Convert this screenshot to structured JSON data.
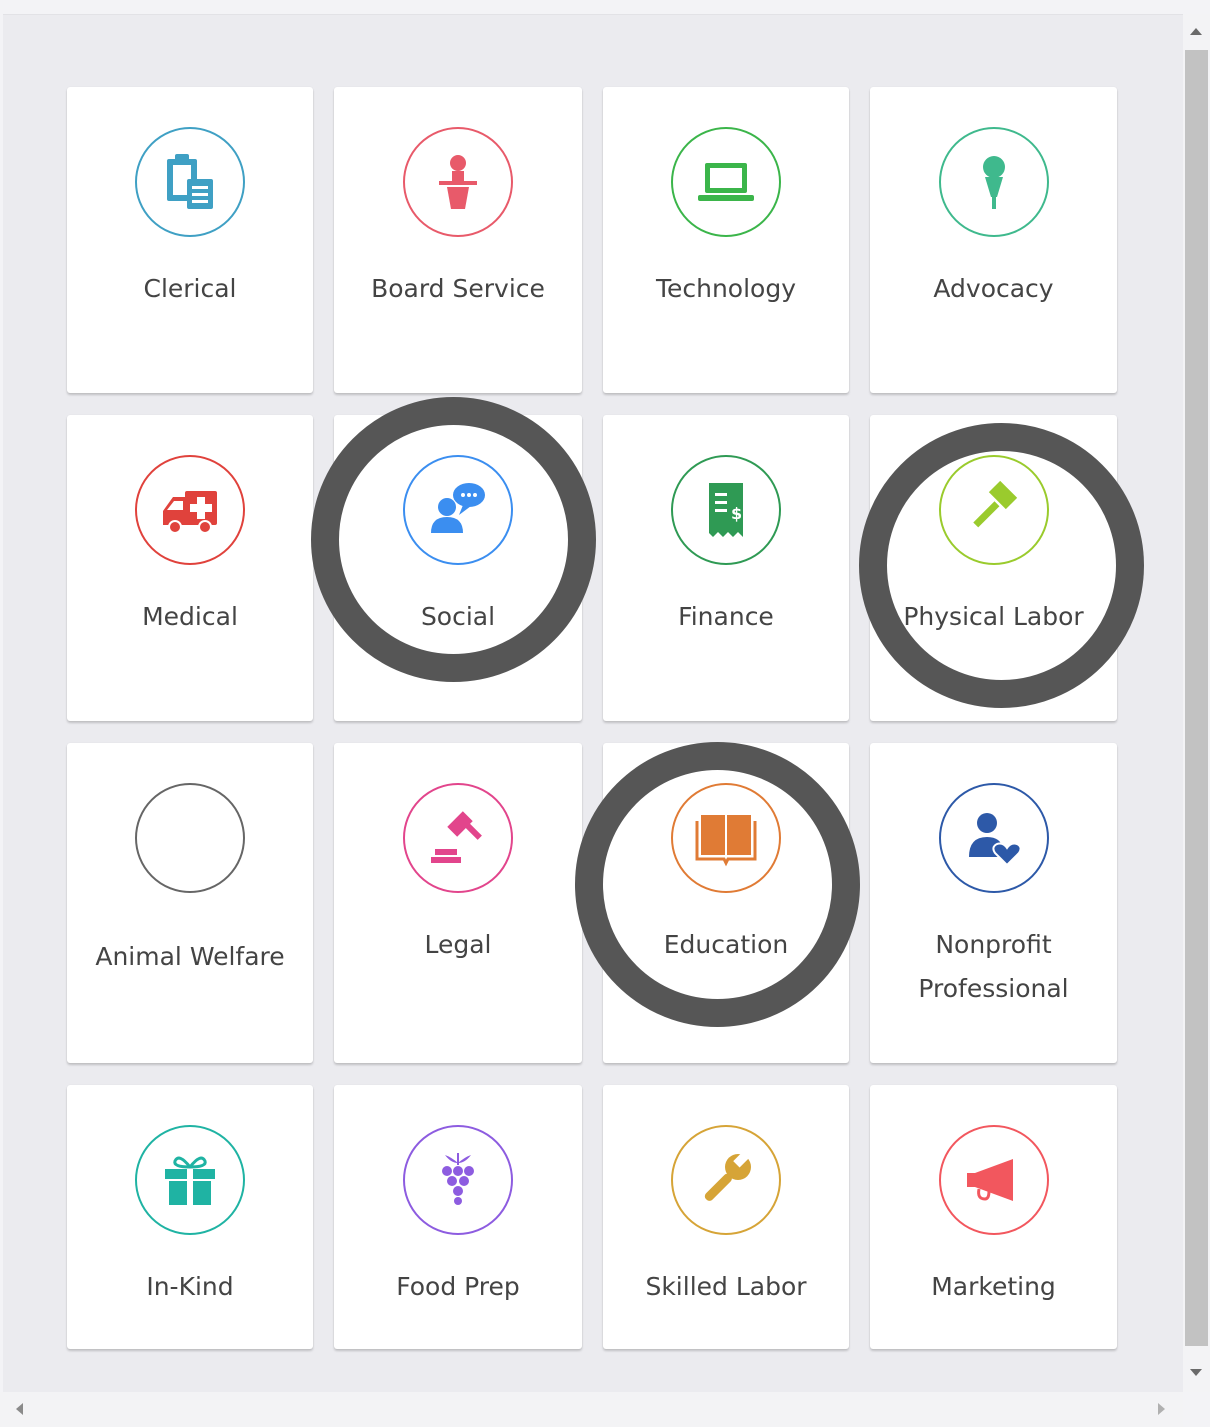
{
  "colors": {
    "blue": "#3fa0c4",
    "red": "#e85a6a",
    "green": "#3bb54a",
    "teal": "#3fb98d",
    "medical_red": "#e0423c",
    "social_blue": "#3b8ef0",
    "finance_green": "#2f9a54",
    "lime": "#9acb2d",
    "gray": "#666666",
    "pink": "#e2458c",
    "orange": "#e07b35",
    "navy": "#2d59a8",
    "cyan": "#1fb3a3",
    "purple": "#8d5ce0",
    "gold": "#d6a437",
    "coral": "#f2575e",
    "highlight": "#565656"
  },
  "categories": [
    {
      "label": "Clerical",
      "icon": "clipboard-icon",
      "color": "#3fa0c4"
    },
    {
      "label": "Board Service",
      "icon": "podium-icon",
      "color": "#e85a6a"
    },
    {
      "label": "Technology",
      "icon": "laptop-icon",
      "color": "#3bb54a"
    },
    {
      "label": "Advocacy",
      "icon": "microphone-icon",
      "color": "#3fb98d"
    },
    {
      "label": "Medical",
      "icon": "ambulance-icon",
      "color": "#e0423c"
    },
    {
      "label": "Social",
      "icon": "people-chat-icon",
      "color": "#3b8ef0",
      "highlighted": true
    },
    {
      "label": "Finance",
      "icon": "receipt-icon",
      "color": "#2f9a54"
    },
    {
      "label": "Physical Labor",
      "icon": "hammer-icon",
      "color": "#9acb2d",
      "highlighted": true
    },
    {
      "label": "Animal Welfare",
      "icon": "blank-icon",
      "color": "#666666"
    },
    {
      "label": "Legal",
      "icon": "gavel-icon",
      "color": "#e2458c"
    },
    {
      "label": "Education",
      "icon": "book-icon",
      "color": "#e07b35",
      "highlighted": true
    },
    {
      "label": "Nonprofit Professional",
      "icon": "person-heart-icon",
      "color": "#2d59a8"
    },
    {
      "label": "In-Kind",
      "icon": "gift-icon",
      "color": "#1fb3a3"
    },
    {
      "label": "Food Prep",
      "icon": "grapes-icon",
      "color": "#8d5ce0"
    },
    {
      "label": "Skilled Labor",
      "icon": "wrench-icon",
      "color": "#d6a437"
    },
    {
      "label": "Marketing",
      "icon": "megaphone-icon",
      "color": "#f2575e"
    }
  ]
}
